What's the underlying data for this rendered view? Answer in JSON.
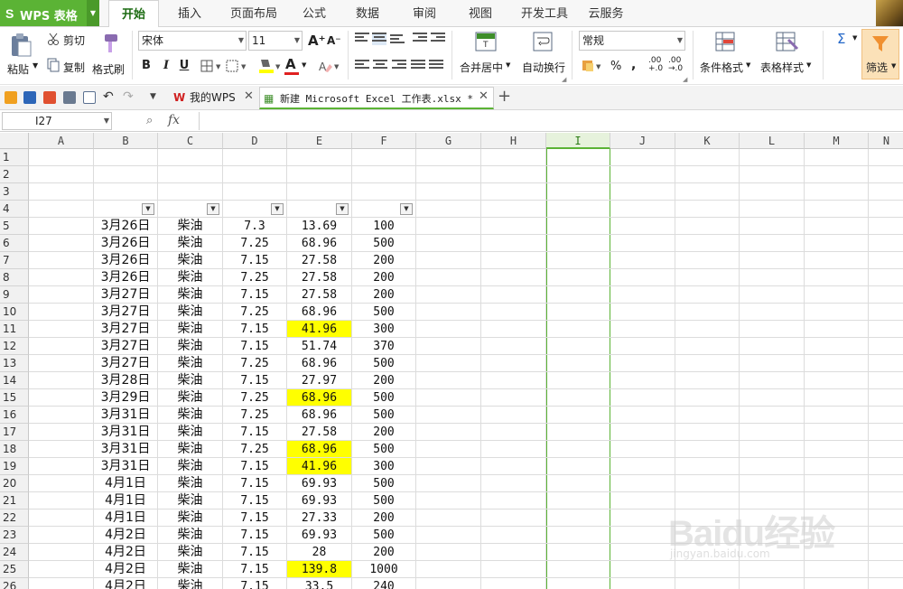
{
  "app": {
    "logo": "S",
    "title": "WPS 表格"
  },
  "menu_tabs": [
    "开始",
    "插入",
    "页面布局",
    "公式",
    "数据",
    "审阅",
    "视图",
    "开发工具",
    "云服务"
  ],
  "ribbon": {
    "paste": "粘贴",
    "cut": "剪切",
    "copy": "复制",
    "format_painter": "格式刷",
    "font_name": "宋体",
    "font_size": "11",
    "bold": "B",
    "italic": "I",
    "underline": "U",
    "font_color_letter": "A",
    "merge_center": "合并居中",
    "wrap_text": "自动换行",
    "number_format": "常规",
    "percent": "%",
    "comma": ",",
    "inc_decimal": ".00\n+.0",
    "dec_decimal": ".00\n→.0",
    "cond_format": "条件格式",
    "table_style": "表格样式",
    "sum": "Σ",
    "filter": "筛选"
  },
  "doc_tabs": [
    {
      "label": "我的WPS",
      "active": false
    },
    {
      "label": "新建 Microsoft Excel 工作表.xlsx *",
      "active": true
    }
  ],
  "formula_bar": {
    "name_box": "I27",
    "fx": "fx",
    "value": ""
  },
  "sheet": {
    "columns": [
      "A",
      "B",
      "C",
      "D",
      "E",
      "F",
      "G",
      "H",
      "I",
      "J",
      "K",
      "L",
      "M",
      "N"
    ],
    "selected_column": "I",
    "row_numbers": [
      "1",
      "2",
      "3",
      "4",
      "5",
      "6",
      "7",
      "8",
      "9",
      "10",
      "11",
      "12",
      "13",
      "14",
      "15",
      "16",
      "17",
      "18",
      "19",
      "20",
      "21",
      "22",
      "23",
      "24",
      "25",
      "26"
    ],
    "data_rows": [
      {
        "row": 5,
        "B": "3月26日",
        "C": "柴油",
        "D": "7.3",
        "E": "13.69",
        "F": "100",
        "hl": false
      },
      {
        "row": 6,
        "B": "3月26日",
        "C": "柴油",
        "D": "7.25",
        "E": "68.96",
        "F": "500",
        "hl": false
      },
      {
        "row": 7,
        "B": "3月26日",
        "C": "柴油",
        "D": "7.15",
        "E": "27.58",
        "F": "200",
        "hl": false
      },
      {
        "row": 8,
        "B": "3月26日",
        "C": "柴油",
        "D": "7.25",
        "E": "27.58",
        "F": "200",
        "hl": false
      },
      {
        "row": 9,
        "B": "3月27日",
        "C": "柴油",
        "D": "7.15",
        "E": "27.58",
        "F": "200",
        "hl": false
      },
      {
        "row": 10,
        "B": "3月27日",
        "C": "柴油",
        "D": "7.25",
        "E": "68.96",
        "F": "500",
        "hl": false
      },
      {
        "row": 11,
        "B": "3月27日",
        "C": "柴油",
        "D": "7.15",
        "E": "41.96",
        "F": "300",
        "hl": true
      },
      {
        "row": 12,
        "B": "3月27日",
        "C": "柴油",
        "D": "7.15",
        "E": "51.74",
        "F": "370",
        "hl": false
      },
      {
        "row": 13,
        "B": "3月27日",
        "C": "柴油",
        "D": "7.25",
        "E": "68.96",
        "F": "500",
        "hl": false
      },
      {
        "row": 14,
        "B": "3月28日",
        "C": "柴油",
        "D": "7.15",
        "E": "27.97",
        "F": "200",
        "hl": false
      },
      {
        "row": 15,
        "B": "3月29日",
        "C": "柴油",
        "D": "7.25",
        "E": "68.96",
        "F": "500",
        "hl": true
      },
      {
        "row": 16,
        "B": "3月31日",
        "C": "柴油",
        "D": "7.25",
        "E": "68.96",
        "F": "500",
        "hl": false
      },
      {
        "row": 17,
        "B": "3月31日",
        "C": "柴油",
        "D": "7.15",
        "E": "27.58",
        "F": "200",
        "hl": false
      },
      {
        "row": 18,
        "B": "3月31日",
        "C": "柴油",
        "D": "7.25",
        "E": "68.96",
        "F": "500",
        "hl": true
      },
      {
        "row": 19,
        "B": "3月31日",
        "C": "柴油",
        "D": "7.15",
        "E": "41.96",
        "F": "300",
        "hl": true
      },
      {
        "row": 20,
        "B": "4月1日",
        "C": "柴油",
        "D": "7.15",
        "E": "69.93",
        "F": "500",
        "hl": false
      },
      {
        "row": 21,
        "B": "4月1日",
        "C": "柴油",
        "D": "7.15",
        "E": "69.93",
        "F": "500",
        "hl": false
      },
      {
        "row": 22,
        "B": "4月1日",
        "C": "柴油",
        "D": "7.15",
        "E": "27.33",
        "F": "200",
        "hl": false
      },
      {
        "row": 23,
        "B": "4月2日",
        "C": "柴油",
        "D": "7.15",
        "E": "69.93",
        "F": "500",
        "hl": false
      },
      {
        "row": 24,
        "B": "4月2日",
        "C": "柴油",
        "D": "7.15",
        "E": "28",
        "F": "200",
        "hl": false
      },
      {
        "row": 25,
        "B": "4月2日",
        "C": "柴油",
        "D": "7.15",
        "E": "139.8",
        "F": "1000",
        "hl": true
      },
      {
        "row": 26,
        "B": "4月2日",
        "C": "柴油",
        "D": "7.15",
        "E": "33.5",
        "F": "240",
        "hl": false
      }
    ],
    "filter_row": 4,
    "filter_columns": [
      "B",
      "C",
      "D",
      "E",
      "F"
    ]
  },
  "watermark": {
    "main": "Baidu经验",
    "sub": "jingyan.baidu.com"
  },
  "colors": {
    "accent": "#5bb335",
    "highlight": "#ffff00"
  }
}
